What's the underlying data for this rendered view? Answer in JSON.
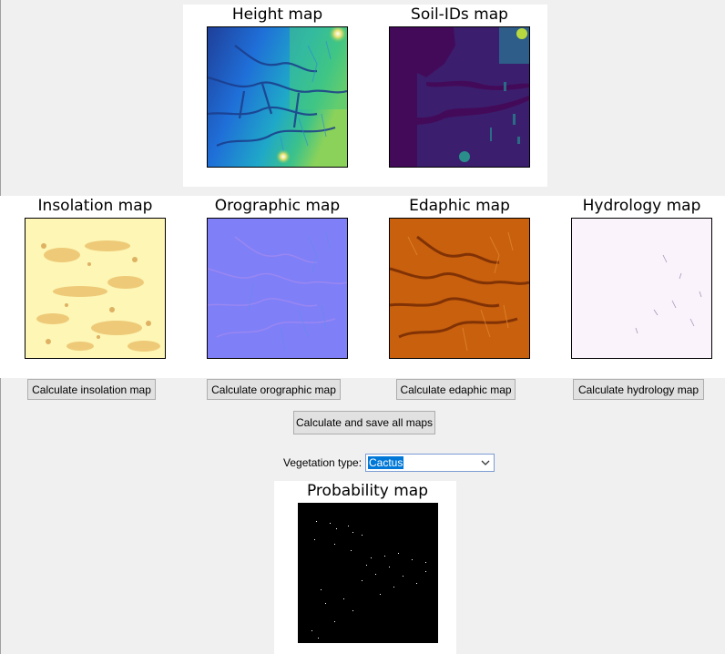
{
  "maps": {
    "height": {
      "title": "Height map"
    },
    "soil": {
      "title": "Soil-IDs map"
    },
    "insolation": {
      "title": "Insolation map"
    },
    "orographic": {
      "title": "Orographic map"
    },
    "edaphic": {
      "title": "Edaphic map"
    },
    "hydrology": {
      "title": "Hydrology map"
    },
    "probability": {
      "title": "Probability map"
    }
  },
  "buttons": {
    "insolation": "Calculate insolation map",
    "orographic": "Calculate orographic map",
    "edaphic": "Calculate edaphic map",
    "hydrology": "Calculate hydrology map",
    "all": "Calculate and save all maps"
  },
  "vegetation": {
    "label": "Vegetation type:",
    "selected": "Cactus",
    "dropdown_icon": "chevron-down-icon"
  },
  "colors": {
    "panel_bg": "#ffffff",
    "window_bg": "#f0f0f0",
    "button_bg": "#e1e1e1",
    "selection": "#0078d7"
  }
}
